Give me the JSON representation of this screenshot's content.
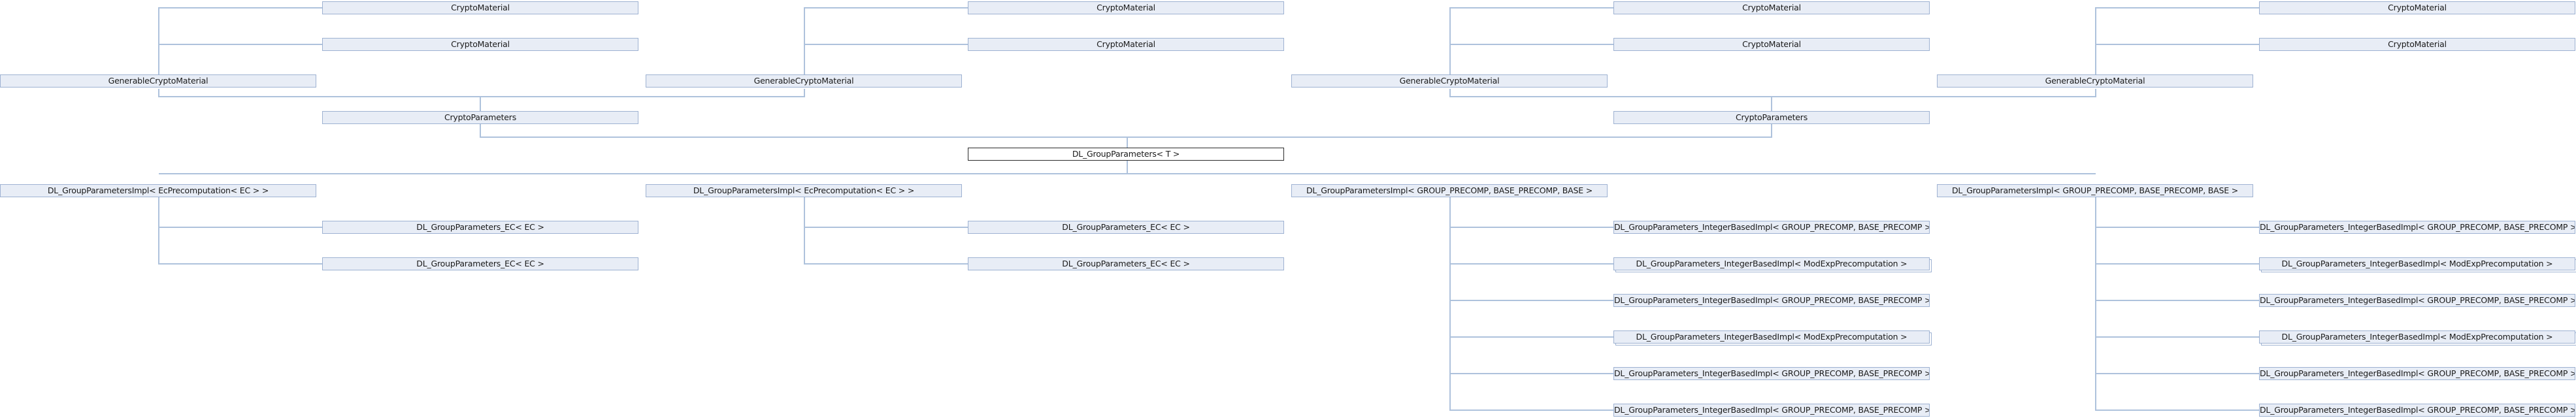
{
  "colors": {
    "node_border": "#9eb2d2",
    "node_fill": "#e8edf6",
    "edge": "#aec2dc",
    "focus_border": "#2b2b2b"
  },
  "nodes": [
    {
      "text": "CryptoMaterial",
      "style": "dashed"
    },
    {
      "text": "CryptoMaterial",
      "style": "dashed"
    },
    {
      "text": "GenerableCryptoMaterial",
      "style": "normal"
    },
    {
      "text": "CryptoMaterial",
      "style": "dashed"
    },
    {
      "text": "CryptoMaterial",
      "style": "dashed"
    },
    {
      "text": "GenerableCryptoMaterial",
      "style": "normal"
    },
    {
      "text": "CryptoMaterial",
      "style": "dashed"
    },
    {
      "text": "CryptoMaterial",
      "style": "dashed"
    },
    {
      "text": "GenerableCryptoMaterial",
      "style": "normal"
    },
    {
      "text": "CryptoMaterial",
      "style": "dashed"
    },
    {
      "text": "CryptoMaterial",
      "style": "dashed"
    },
    {
      "text": "GenerableCryptoMaterial",
      "style": "normal"
    },
    {
      "text": "CryptoParameters",
      "style": "normal"
    },
    {
      "text": "CryptoParameters",
      "style": "normal"
    },
    {
      "text": "DL_GroupParameters< T >",
      "style": "focus"
    },
    {
      "text": "DL_GroupParametersImpl< EcPrecomputation< EC > >",
      "style": "normal"
    },
    {
      "text": "DL_GroupParametersImpl< EcPrecomputation< EC > >",
      "style": "normal"
    },
    {
      "text": "DL_GroupParametersImpl< GROUP_PRECOMP, BASE_PRECOMP, BASE >",
      "style": "normal"
    },
    {
      "text": "DL_GroupParametersImpl< GROUP_PRECOMP, BASE_PRECOMP, BASE >",
      "style": "normal"
    },
    {
      "text": "DL_GroupParameters_EC< EC >",
      "style": "normal"
    },
    {
      "text": "DL_GroupParameters_EC< EC >",
      "style": "normal"
    },
    {
      "text": "DL_GroupParameters_EC< EC >",
      "style": "normal"
    },
    {
      "text": "DL_GroupParameters_EC< EC >",
      "style": "normal"
    },
    {
      "text": "DL_GroupParameters_IntegerBasedImpl< GROUP_PRECOMP, BASE_PRECOMP >",
      "style": "normal"
    },
    {
      "text": "DL_GroupParameters_IntegerBasedImpl< ModExpPrecomputation >",
      "style": "trunc"
    },
    {
      "text": "DL_GroupParameters_IntegerBasedImpl< GROUP_PRECOMP, BASE_PRECOMP >",
      "style": "normal"
    },
    {
      "text": "DL_GroupParameters_IntegerBasedImpl< ModExpPrecomputation >",
      "style": "trunc"
    },
    {
      "text": "DL_GroupParameters_IntegerBasedImpl< GROUP_PRECOMP, BASE_PRECOMP >",
      "style": "normal"
    },
    {
      "text": "DL_GroupParameters_IntegerBasedImpl< GROUP_PRECOMP, BASE_PRECOMP >",
      "style": "normal"
    },
    {
      "text": "DL_GroupParameters_IntegerBasedImpl< GROUP_PRECOMP, BASE_PRECOMP >",
      "style": "normal"
    },
    {
      "text": "DL_GroupParameters_IntegerBasedImpl< ModExpPrecomputation >",
      "style": "trunc"
    },
    {
      "text": "DL_GroupParameters_IntegerBasedImpl< GROUP_PRECOMP, BASE_PRECOMP >",
      "style": "normal"
    },
    {
      "text": "DL_GroupParameters_IntegerBasedImpl< ModExpPrecomputation >",
      "style": "trunc"
    },
    {
      "text": "DL_GroupParameters_IntegerBasedImpl< GROUP_PRECOMP, BASE_PRECOMP >",
      "style": "normal"
    },
    {
      "text": "DL_GroupParameters_IntegerBasedImpl< GROUP_PRECOMP, BASE_PRECOMP >",
      "style": "normal"
    }
  ]
}
